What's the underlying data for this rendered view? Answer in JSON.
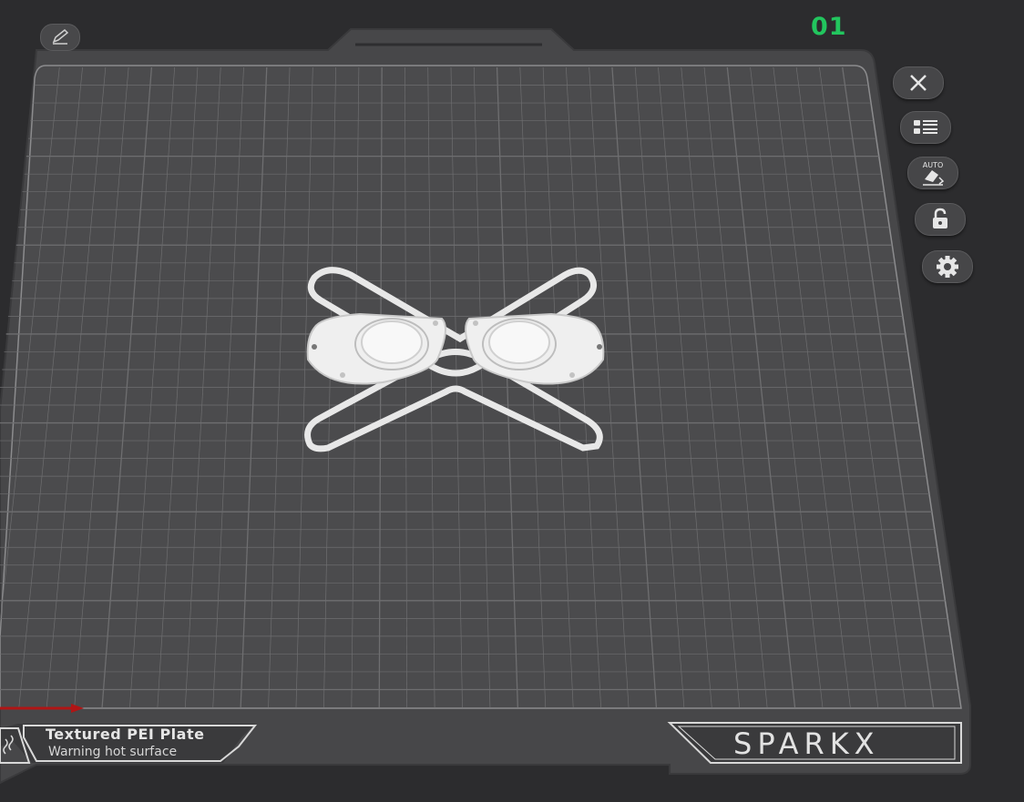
{
  "plate": {
    "number": "01",
    "label_title": "Textured PEI Plate",
    "label_warning": "Warning hot surface",
    "brand": "SPARKX"
  },
  "toolbar": {
    "buttons": [
      {
        "name": "close-plate-button",
        "icon": "close-icon"
      },
      {
        "name": "objects-list-button",
        "icon": "list-icon"
      },
      {
        "name": "auto-orient-button",
        "icon": "auto-arrange-icon",
        "badge": "AUTO"
      },
      {
        "name": "lock-plate-button",
        "icon": "lock-icon"
      },
      {
        "name": "plate-settings-button",
        "icon": "gear-icon"
      }
    ],
    "edit_icon": "pencil-icon"
  },
  "colors": {
    "background": "#2c2c2e",
    "plate": "#474749",
    "grid": "#6e6e70",
    "plate_number": "#22c55e",
    "model": "#ececec",
    "x_axis": "#b01515"
  }
}
